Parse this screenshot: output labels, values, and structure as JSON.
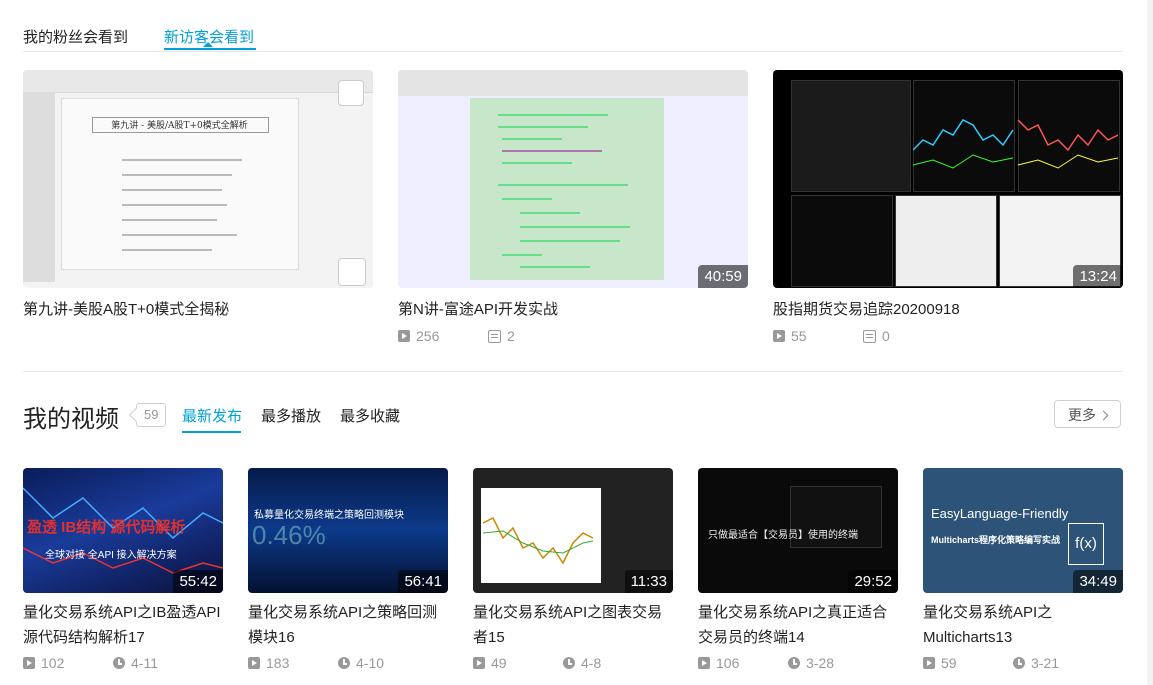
{
  "top_tabs": [
    "我的粉丝会看到",
    "新访客会看到"
  ],
  "featured": [
    {
      "title": "第九讲-美股A股T+0模式全揭秘",
      "duration": "",
      "plays": "",
      "danmu": ""
    },
    {
      "title": "第N讲-富途API开发实战",
      "duration": "40:59",
      "plays": "256",
      "danmu": "2"
    },
    {
      "title": "股指期货交易追踪20200918",
      "duration": "13:24",
      "plays": "55",
      "danmu": "0"
    }
  ],
  "my_videos": {
    "title": "我的视频",
    "count": "59",
    "sort_tabs": [
      "最新发布",
      "最多播放",
      "最多收藏"
    ],
    "more": "更多",
    "items": [
      {
        "title_line1": "量化交易系统API之IB盈透API",
        "title_line2": "源代码结构解析17",
        "duration": "55:42",
        "plays": "102",
        "date": "4-11",
        "overlay1": "盈透 IB结构 源代码解析",
        "overlay2": "全球对接 全API 接入解决方案"
      },
      {
        "title_line1": "量化交易系统API之策略回测",
        "title_line2": "模块16",
        "duration": "56:41",
        "plays": "183",
        "date": "4-10",
        "overlay1": "私募量化交易终端之策略回测模块",
        "overlay2": "0.46%"
      },
      {
        "title_line1": "量化交易系统API之图表交易",
        "title_line2": "者15",
        "duration": "11:33",
        "plays": "49",
        "date": "4-8"
      },
      {
        "title_line1": "量化交易系统API之真正适合",
        "title_line2": "交易员的终端14",
        "duration": "29:52",
        "plays": "106",
        "date": "3-28",
        "overlay1": "只做最适合【交易员】使用的终端"
      },
      {
        "title_line1": "量化交易系统API之",
        "title_line2": "Multicharts13",
        "duration": "34:49",
        "plays": "59",
        "date": "3-21",
        "overlay1": "EasyLanguage-Friendly",
        "overlay2": "Multicharts程序化策略编写实战",
        "overlay3": "f(x)"
      }
    ]
  },
  "slide_text": {
    "heading": "第九讲 - 美股/A股T+0模式全解析"
  },
  "colors": {
    "accent": "#00a1d6",
    "muted": "#999999"
  }
}
